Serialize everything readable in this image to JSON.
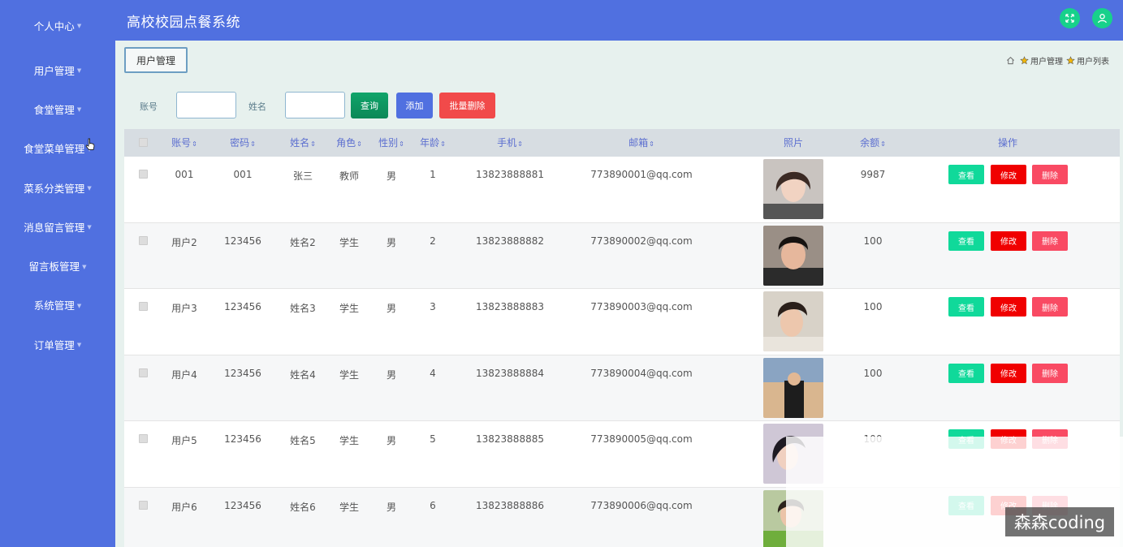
{
  "app": {
    "title": "高校校园点餐系统"
  },
  "sidebar": {
    "items": [
      {
        "label": "个人中心"
      },
      {
        "label": "用户管理"
      },
      {
        "label": "食堂管理"
      },
      {
        "label": "食堂菜单管理"
      },
      {
        "label": "菜系分类管理"
      },
      {
        "label": "消息留言管理"
      },
      {
        "label": "留言板管理"
      },
      {
        "label": "系统管理"
      },
      {
        "label": "订单管理"
      }
    ]
  },
  "page_tab": "用户管理",
  "breadcrumb": {
    "level1": "用户管理",
    "level2": "用户列表"
  },
  "search": {
    "account_label": "账号",
    "name_label": "姓名",
    "search_button": "查询",
    "add_button": "添加",
    "batch_delete_button": "批量删除"
  },
  "table": {
    "headers": {
      "account": "账号",
      "password": "密码",
      "name": "姓名",
      "role": "角色",
      "gender": "性别",
      "age": "年龄",
      "phone": "手机",
      "email": "邮箱",
      "photo": "照片",
      "balance": "余额",
      "actions": "操作"
    },
    "sort_icon": "⇕",
    "action_labels": {
      "view": "查看",
      "edit": "修改",
      "delete": "删除"
    },
    "rows": [
      {
        "account": "001",
        "password": "001",
        "name": "张三",
        "role": "教师",
        "gender": "男",
        "age": "1",
        "phone": "13823888881",
        "email": "773890001@qq.com",
        "balance": "9987"
      },
      {
        "account": "用户2",
        "password": "123456",
        "name": "姓名2",
        "role": "学生",
        "gender": "男",
        "age": "2",
        "phone": "13823888882",
        "email": "773890002@qq.com",
        "balance": "100"
      },
      {
        "account": "用户3",
        "password": "123456",
        "name": "姓名3",
        "role": "学生",
        "gender": "男",
        "age": "3",
        "phone": "13823888883",
        "email": "773890003@qq.com",
        "balance": "100"
      },
      {
        "account": "用户4",
        "password": "123456",
        "name": "姓名4",
        "role": "学生",
        "gender": "男",
        "age": "4",
        "phone": "13823888884",
        "email": "773890004@qq.com",
        "balance": "100"
      },
      {
        "account": "用户5",
        "password": "123456",
        "name": "姓名5",
        "role": "学生",
        "gender": "男",
        "age": "5",
        "phone": "13823888885",
        "email": "773890005@qq.com",
        "balance": "100"
      },
      {
        "account": "用户6",
        "password": "123456",
        "name": "姓名6",
        "role": "学生",
        "gender": "男",
        "age": "6",
        "phone": "13823888886",
        "email": "773890006@qq.com",
        "balance": ""
      }
    ]
  },
  "watermark": "森森coding",
  "colors": {
    "primary": "#5070e0",
    "success": "#10d99a",
    "danger": "#f00000",
    "delete": "#f94a63",
    "top_icon": "#17d18b"
  }
}
